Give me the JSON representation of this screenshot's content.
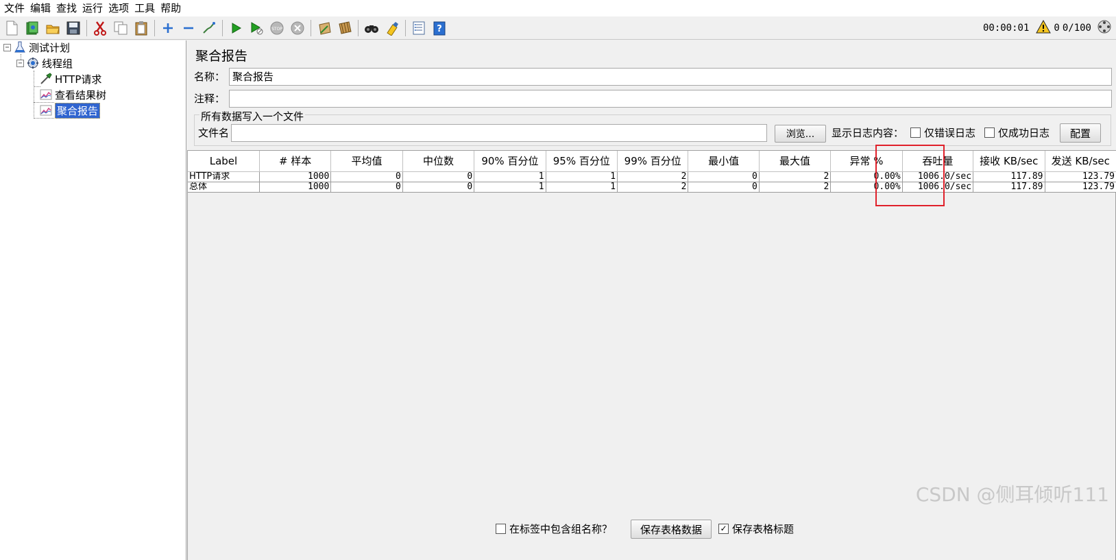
{
  "menu": [
    "文件",
    "编辑",
    "查找",
    "运行",
    "选项",
    "工具",
    "帮助"
  ],
  "toolbar": {
    "timer": "00:00:01",
    "error_count": "0",
    "threads": "0/100"
  },
  "tree": {
    "items": [
      {
        "label": "测试计划",
        "icon": "test-plan-icon"
      },
      {
        "label": "线程组",
        "icon": "thread-group-icon"
      },
      {
        "label": "HTTP请求",
        "icon": "http-sampler-icon"
      },
      {
        "label": "查看结果树",
        "icon": "listener-graph-icon"
      },
      {
        "label": "聚合报告",
        "icon": "listener-graph-icon"
      }
    ]
  },
  "panel": {
    "title": "聚合报告",
    "name_label": "名称：",
    "name_value": "聚合报告",
    "comment_label": "注释：",
    "comment_value": "",
    "file_group_title": "所有数据写入一个文件",
    "file_label": "文件名",
    "file_value": "",
    "browse_label": "浏览...",
    "log_label": "显示日志内容：",
    "errors_only_label": "仅错误日志",
    "success_only_label": "仅成功日志",
    "config_label": "配置"
  },
  "table": {
    "headers": [
      "Label",
      "# 样本",
      "平均值",
      "中位数",
      "90% 百分位",
      "95% 百分位",
      "99% 百分位",
      "最小值",
      "最大值",
      "异常 %",
      "吞吐量",
      "接收 KB/sec",
      "发送 KB/sec"
    ],
    "rows": [
      [
        "HTTP请求",
        "1000",
        "0",
        "0",
        "1",
        "1",
        "2",
        "0",
        "2",
        "0.00%",
        "1006.0/sec",
        "117.89",
        "123.79"
      ],
      [
        "总体",
        "1000",
        "0",
        "0",
        "1",
        "1",
        "2",
        "0",
        "2",
        "0.00%",
        "1006.0/sec",
        "117.89",
        "123.79"
      ]
    ]
  },
  "bottom": {
    "include_group_label": "在标签中包含组名称？",
    "save_data_label": "保存表格数据",
    "save_header_label": "保存表格标题"
  },
  "watermark": "CSDN @侧耳倾听111",
  "colors": {
    "selection": "#2f64d0",
    "highlight": "#e0202a"
  }
}
